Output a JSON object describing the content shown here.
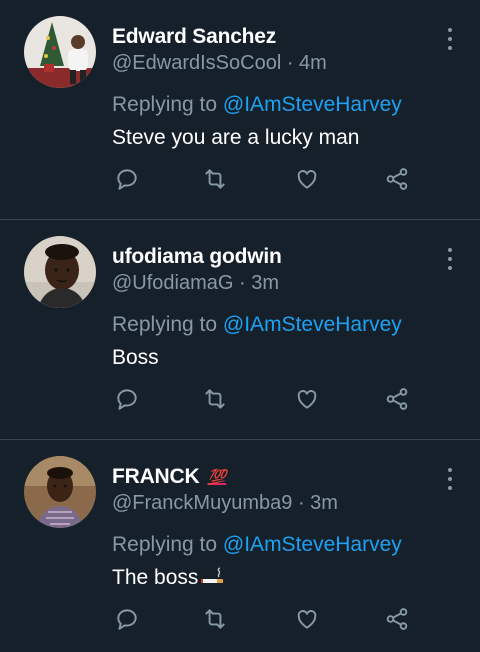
{
  "replies": [
    {
      "name": "Edward Sanchez",
      "badge": "",
      "handle": "@EdwardIsSoCool",
      "time": "· 4m",
      "replying_prefix": "Replying to ",
      "replying_to": "@IAmSteveHarvey",
      "text": "Steve you are a lucky man",
      "avatar_icon": "christmas-tree-photo"
    },
    {
      "name": "ufodiama godwin",
      "badge": "",
      "handle": "@UfodiamaG",
      "time": "· 3m",
      "replying_prefix": "Replying to ",
      "replying_to": "@IAmSteveHarvey",
      "text": "Boss",
      "avatar_icon": "profile-photo"
    },
    {
      "name": "FRANCK",
      "badge": "💯",
      "handle": "@FranckMuyumba9",
      "time": "· 3m",
      "replying_prefix": "Replying to ",
      "replying_to": "@IAmSteveHarvey",
      "text": "The boss",
      "avatar_icon": "profile-photo"
    }
  ],
  "actions": [
    "reply-icon",
    "retweet-icon",
    "like-icon",
    "share-icon"
  ],
  "colors": {
    "background": "#15202b",
    "muted": "#8899a6",
    "accent": "#1da1f2",
    "divider": "#38444d"
  }
}
